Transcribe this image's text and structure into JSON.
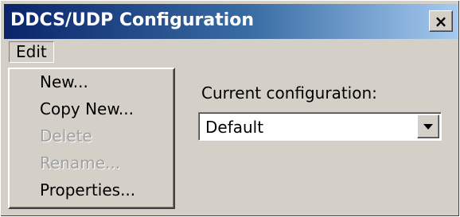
{
  "window": {
    "title": "DDCS/UDP Configuration",
    "close_label": "×"
  },
  "menubar": {
    "edit_label": "Edit"
  },
  "edit_menu": {
    "items": [
      {
        "label": "New...",
        "enabled": true
      },
      {
        "label": "Copy New...",
        "enabled": true
      },
      {
        "label": "Delete",
        "enabled": false
      },
      {
        "label": "Rename...",
        "enabled": false
      },
      {
        "label": "Properties...",
        "enabled": true
      }
    ]
  },
  "config": {
    "label": "Current configuration:",
    "selected": "Default"
  },
  "icons": {
    "close": "close-icon",
    "dropdown": "chevron-down-icon"
  },
  "colors": {
    "titlebar_start": "#0a246a",
    "titlebar_end": "#a6caf0",
    "face": "#d4d0c8"
  }
}
